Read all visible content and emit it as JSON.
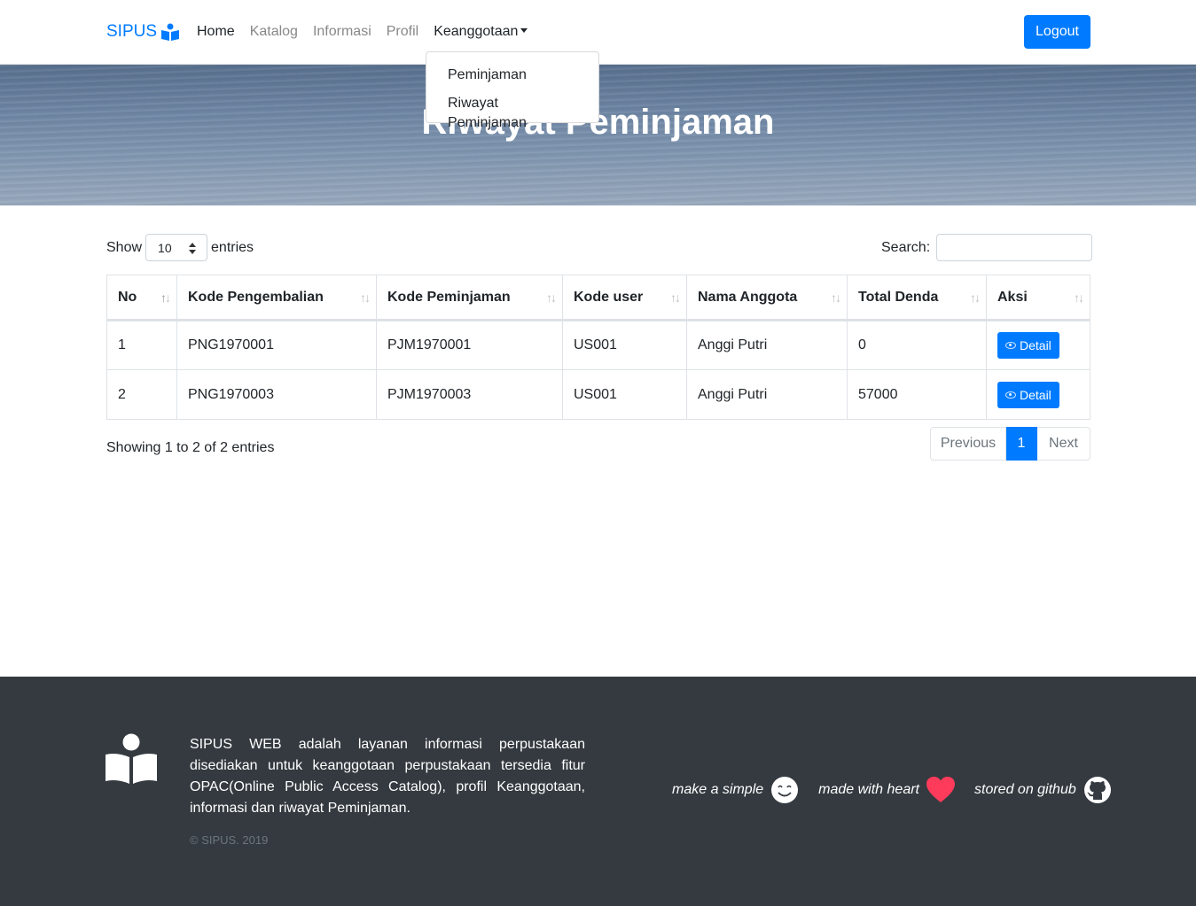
{
  "navbar": {
    "brand": "SIPUS",
    "links": [
      "Home",
      "Katalog",
      "Informasi",
      "Profil"
    ],
    "dropdown_label": "Keanggotaan",
    "dropdown_items": [
      "Peminjaman",
      "Riwayat Peminjaman"
    ],
    "logout_label": "Logout"
  },
  "hero": {
    "title": "Riwayat Peminjaman"
  },
  "controls": {
    "show_label": "Show",
    "length_value": "10",
    "entries_label": "entries",
    "search_label": "Search:"
  },
  "table": {
    "headers": [
      "No",
      "Kode Pengembalian",
      "Kode Peminjaman",
      "Kode user",
      "Nama Anggota",
      "Total Denda",
      "Aksi"
    ],
    "rows": [
      {
        "no": "1",
        "kode_pengembalian": "PNG1970001",
        "kode_peminjaman": "PJM1970001",
        "kode_user": "US001",
        "nama": "Anggi Putri",
        "denda": "0",
        "aksi": "Detail"
      },
      {
        "no": "2",
        "kode_pengembalian": "PNG1970003",
        "kode_peminjaman": "PJM1970003",
        "kode_user": "US001",
        "nama": "Anggi Putri",
        "denda": "57000",
        "aksi": "Detail"
      }
    ]
  },
  "info": "Showing 1 to 2 of 2 entries",
  "pagination": {
    "previous": "Previous",
    "current": "1",
    "next": "Next"
  },
  "footer": {
    "description": "SIPUS WEB adalah layanan informasi perpustakaan disediakan untuk keanggotaan perpustakaan tersedia fitur OPAC(Online Public Access Catalog), profil Keanggotaan, informasi dan riwayat Peminjaman.",
    "copyright": "© SIPUS. 2019",
    "badges": [
      "make a simple",
      "made with heart",
      "stored on github"
    ]
  },
  "colors": {
    "primary": "#007bff",
    "footer_bg": "#343a40",
    "heart": "#ff3b5c"
  },
  "icons": [
    "book-reader-icon",
    "sort-icon",
    "eye-icon",
    "smile-icon",
    "heart-icon",
    "github-icon"
  ]
}
